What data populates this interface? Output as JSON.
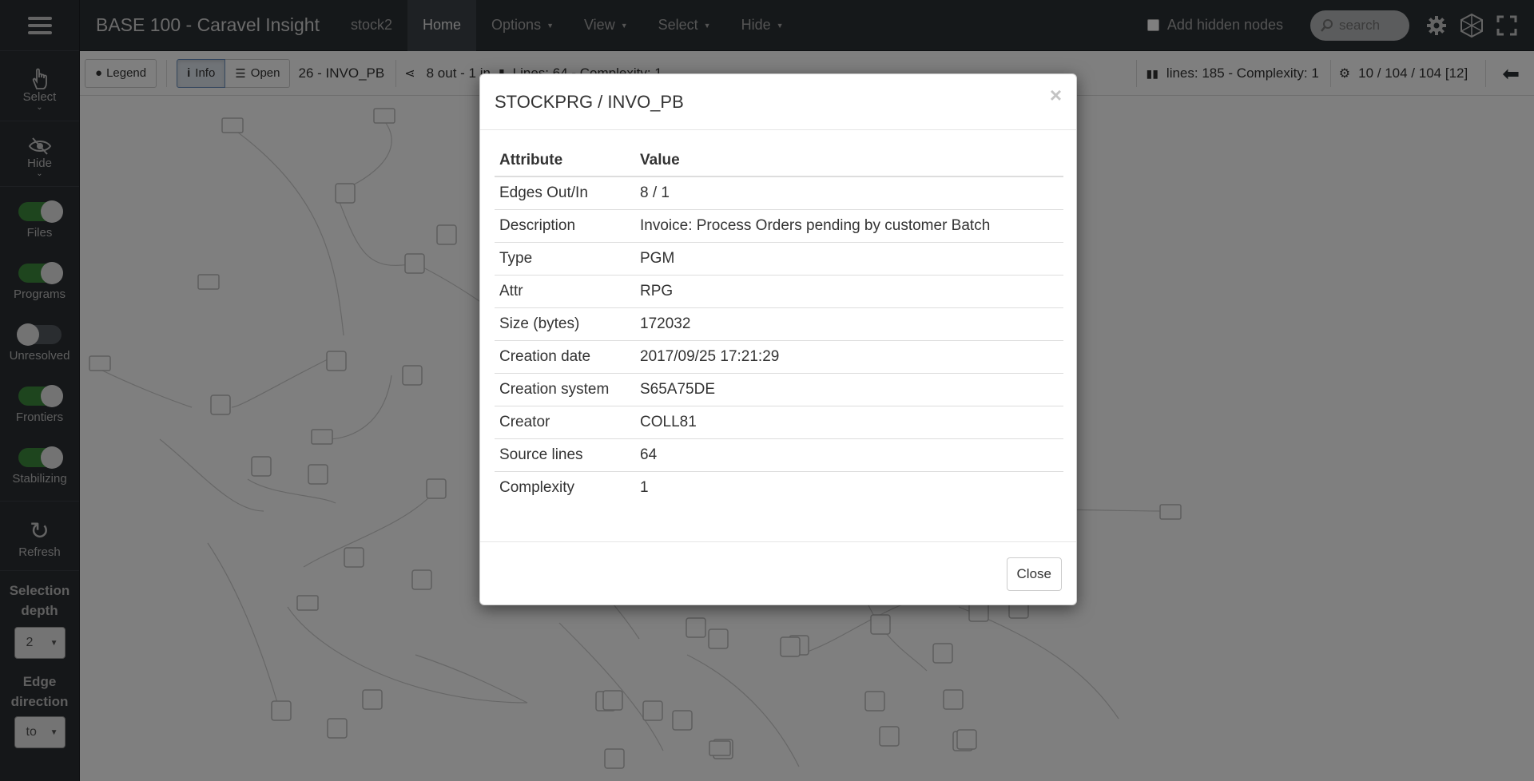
{
  "navbar": {
    "brand": "BASE 100 - Caravel Insight",
    "project": "stock2",
    "links": [
      {
        "label": "Home"
      },
      {
        "label": "Options"
      },
      {
        "label": "View"
      },
      {
        "label": "Select"
      },
      {
        "label": "Hide"
      }
    ],
    "add_hidden_nodes": "Add hidden nodes",
    "search_placeholder": "search"
  },
  "sidebar": {
    "select_label": "Select",
    "hide_label": "Hide",
    "toggles": [
      {
        "label": "Files",
        "on": true
      },
      {
        "label": "Programs",
        "on": true
      },
      {
        "label": "Unresolved",
        "on": false
      },
      {
        "label": "Frontiers",
        "on": true
      },
      {
        "label": "Stabilizing",
        "on": true
      }
    ],
    "refresh_label": "Refresh",
    "selection_depth_label_1": "Selection",
    "selection_depth_label_2": "depth",
    "selection_depth_value": "2",
    "edge_direction_label_1": "Edge",
    "edge_direction_label_2": "direction",
    "edge_direction_value": "to"
  },
  "toolbar": {
    "legend": "Legend",
    "info": "Info",
    "open": "Open",
    "node_title": "26 - INVO_PB",
    "edges_summary": "8 out - 1 in",
    "lines_summary": "Lines: 64 - Complexity: 1",
    "global_lines": "lines: 185 - Complexity: 1",
    "counts": "10 / 104 / 104 [12]"
  },
  "modal": {
    "title": "STOCKPRG / INVO_PB",
    "close_x": "×",
    "headers": [
      "Attribute",
      "Value"
    ],
    "rows": [
      {
        "attr": "Edges Out/In",
        "value": "8 / 1"
      },
      {
        "attr": "Description",
        "value": "Invoice: Process Orders pending by customer Batch"
      },
      {
        "attr": "Type",
        "value": "PGM"
      },
      {
        "attr": "Attr",
        "value": "RPG"
      },
      {
        "attr": "Size (bytes)",
        "value": "172032"
      },
      {
        "attr": "Creation date",
        "value": "2017/09/25 17:21:29"
      },
      {
        "attr": "Creation system",
        "value": "S65A75DE"
      },
      {
        "attr": "Creator",
        "value": "COLL81"
      },
      {
        "attr": "Source lines",
        "value": "64"
      },
      {
        "attr": "Complexity",
        "value": "1"
      }
    ],
    "close_button": "Close"
  }
}
